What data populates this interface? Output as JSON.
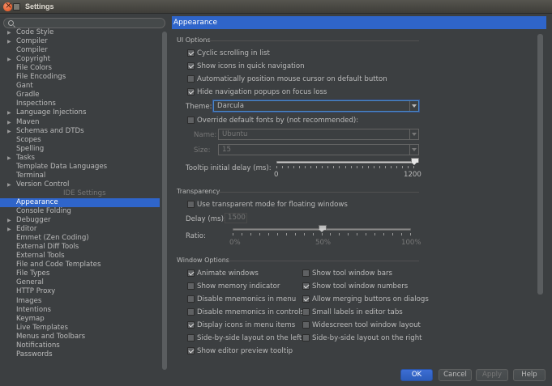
{
  "window": {
    "title": "Settings"
  },
  "search": {
    "placeholder": ""
  },
  "tree": {
    "items": [
      {
        "label": "Code Style",
        "arrow": true
      },
      {
        "label": "Compiler",
        "arrow": true
      },
      {
        "label": "Compiler",
        "arrow": false
      },
      {
        "label": "Copyright",
        "arrow": true
      },
      {
        "label": "File Colors",
        "arrow": false
      },
      {
        "label": "File Encodings",
        "arrow": false
      },
      {
        "label": "Gant",
        "arrow": false
      },
      {
        "label": "Gradle",
        "arrow": false
      },
      {
        "label": "Inspections",
        "arrow": false
      },
      {
        "label": "Language Injections",
        "arrow": true
      },
      {
        "label": "Maven",
        "arrow": true
      },
      {
        "label": "Schemas and DTDs",
        "arrow": true
      },
      {
        "label": "Scopes",
        "arrow": false
      },
      {
        "label": "Spelling",
        "arrow": false
      },
      {
        "label": "Tasks",
        "arrow": true
      },
      {
        "label": "Template Data Languages",
        "arrow": false
      },
      {
        "label": "Terminal",
        "arrow": false
      },
      {
        "label": "Version Control",
        "arrow": true
      },
      {
        "label": "IDE Settings",
        "section": true
      },
      {
        "label": "Appearance",
        "selected": true
      },
      {
        "label": "Console Folding",
        "arrow": false
      },
      {
        "label": "Debugger",
        "arrow": true
      },
      {
        "label": "Editor",
        "arrow": true
      },
      {
        "label": "Emmet (Zen Coding)",
        "arrow": false
      },
      {
        "label": "External Diff Tools",
        "arrow": false
      },
      {
        "label": "External Tools",
        "arrow": false
      },
      {
        "label": "File and Code Templates",
        "arrow": false
      },
      {
        "label": "File Types",
        "arrow": false
      },
      {
        "label": "General",
        "arrow": false
      },
      {
        "label": "HTTP Proxy",
        "arrow": false
      },
      {
        "label": "Images",
        "arrow": false
      },
      {
        "label": "Intentions",
        "arrow": false
      },
      {
        "label": "Keymap",
        "arrow": false
      },
      {
        "label": "Live Templates",
        "arrow": false
      },
      {
        "label": "Menus and Toolbars",
        "arrow": false
      },
      {
        "label": "Notifications",
        "arrow": false
      },
      {
        "label": "Passwords",
        "arrow": false
      }
    ]
  },
  "panel": {
    "header": "Appearance",
    "ui_options": {
      "title": "UI Options",
      "cyclic": {
        "label": "Cyclic scrolling in list",
        "checked": true
      },
      "icons_quick_nav": {
        "label": "Show icons in quick navigation",
        "checked": true
      },
      "auto_mouse": {
        "label": "Automatically position mouse cursor on default button",
        "checked": false
      },
      "hide_popups": {
        "label": "Hide navigation popups on focus loss",
        "checked": true
      },
      "theme_label": "Theme:",
      "theme_value": "Darcula",
      "override_fonts": {
        "label": "Override default fonts by (not recommended):",
        "checked": false
      },
      "name_label": "Name:",
      "name_value": "Ubuntu",
      "size_label": "Size:",
      "size_value": "15",
      "tooltip_label": "Tooltip initial delay (ms):",
      "tooltip_min": "0",
      "tooltip_max": "1200",
      "tooltip_value": 1200
    },
    "transparency": {
      "title": "Transparency",
      "transparent_mode": {
        "label": "Use transparent mode for floating windows",
        "checked": false
      },
      "delay_label": "Delay (ms):",
      "delay_value": "1500",
      "ratio_label": "Ratio:",
      "ratio_ticks": [
        "0%",
        "50%",
        "100%"
      ],
      "ratio_value": 0.5
    },
    "window_options": {
      "title": "Window Options",
      "left": [
        {
          "label": "Animate windows",
          "checked": true
        },
        {
          "label": "Show memory indicator",
          "checked": false
        },
        {
          "label": "Disable mnemonics in menu",
          "checked": false
        },
        {
          "label": "Disable mnemonics in controls",
          "checked": false
        },
        {
          "label": "Display icons in menu items",
          "checked": true
        },
        {
          "label": "Side-by-side layout on the left",
          "checked": false
        },
        {
          "label": "Show editor preview tooltip",
          "checked": true
        }
      ],
      "right": [
        {
          "label": "Show tool window bars",
          "checked": false
        },
        {
          "label": "Show tool window numbers",
          "checked": true
        },
        {
          "label": "Allow merging buttons on dialogs",
          "checked": true
        },
        {
          "label": "Small labels in editor tabs",
          "checked": false
        },
        {
          "label": "Widescreen tool window layout",
          "checked": false
        },
        {
          "label": "Side-by-side layout on the right",
          "checked": false
        }
      ]
    }
  },
  "buttons": {
    "ok": "OK",
    "cancel": "Cancel",
    "apply": "Apply",
    "help": "Help"
  }
}
